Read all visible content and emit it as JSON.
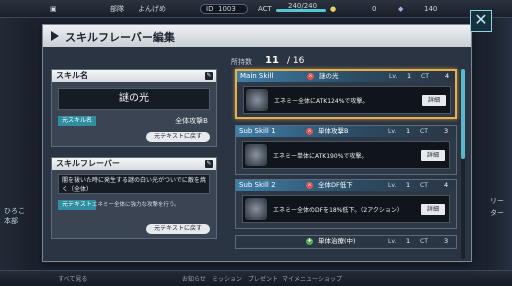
{
  "hud": {
    "rank_label": "部隊",
    "player_name": "よんげめ",
    "id_label": "ID",
    "id_value": "1003",
    "act_label": "ACT",
    "act_value": "240/240",
    "coin_value": "0",
    "gem_value": "140"
  },
  "background": {
    "left_label_1": "ひろこ",
    "left_label_2": "本部",
    "right_label_1": "リー",
    "right_label_2": "ター",
    "bottom_labels": [
      "すべて見る",
      "お知らせ",
      "ミッション",
      "プレゼント",
      "マイメニュー",
      "ショップ"
    ]
  },
  "dialog": {
    "title": "スキルフレーバー編集",
    "close_glyph": "✕"
  },
  "skill_name_panel": {
    "header": "スキル名",
    "name": "謎の光",
    "original_tag": "元スキル名",
    "original_value": "全体攻撃B",
    "restore_button": "元テキストに戻す"
  },
  "flavor_panel": {
    "header": "スキルフレーバー",
    "flavor_text": "闇を祓いた時に発生する謎の白い光がついでに敵を焼く（全体）",
    "original_tag": "元テキスト",
    "original_value": "エネミー全体に強力な攻撃を行う。",
    "restore_button": "元テキストに戻す"
  },
  "skills_list": {
    "count_label": "所持数",
    "count_value": "11",
    "count_total": "/ 16",
    "detail_label": "詳細",
    "lv_label": "Lv.",
    "ct_label": "CT",
    "items": [
      {
        "slot": "Main Skill",
        "type_icon": "attack-icon",
        "name": "謎の光",
        "lv": "1",
        "ct": "4",
        "desc": "エネミー全体にATK124%で攻撃。",
        "selected": true
      },
      {
        "slot": "Sub Skill 1",
        "type_icon": "attack-icon",
        "name": "単体攻撃B",
        "lv": "1",
        "ct": "3",
        "desc": "エネミー単体にATK190%で攻撃。",
        "selected": false
      },
      {
        "slot": "Sub Skill 2",
        "type_icon": "attack-icon",
        "name": "全体DF低下",
        "lv": "1",
        "ct": "4",
        "desc": "エネミー全体のDFを18%低下。（2アクション）",
        "selected": false
      },
      {
        "slot": "",
        "type_icon": "heal-icon",
        "name": "単体治療(中)",
        "lv": "1",
        "ct": "3",
        "desc": "",
        "selected": false
      }
    ]
  },
  "colors": {
    "accent": "#5cb8c8",
    "selected_border": "#e8b04a",
    "tag_bg": "#2f8fa1"
  }
}
